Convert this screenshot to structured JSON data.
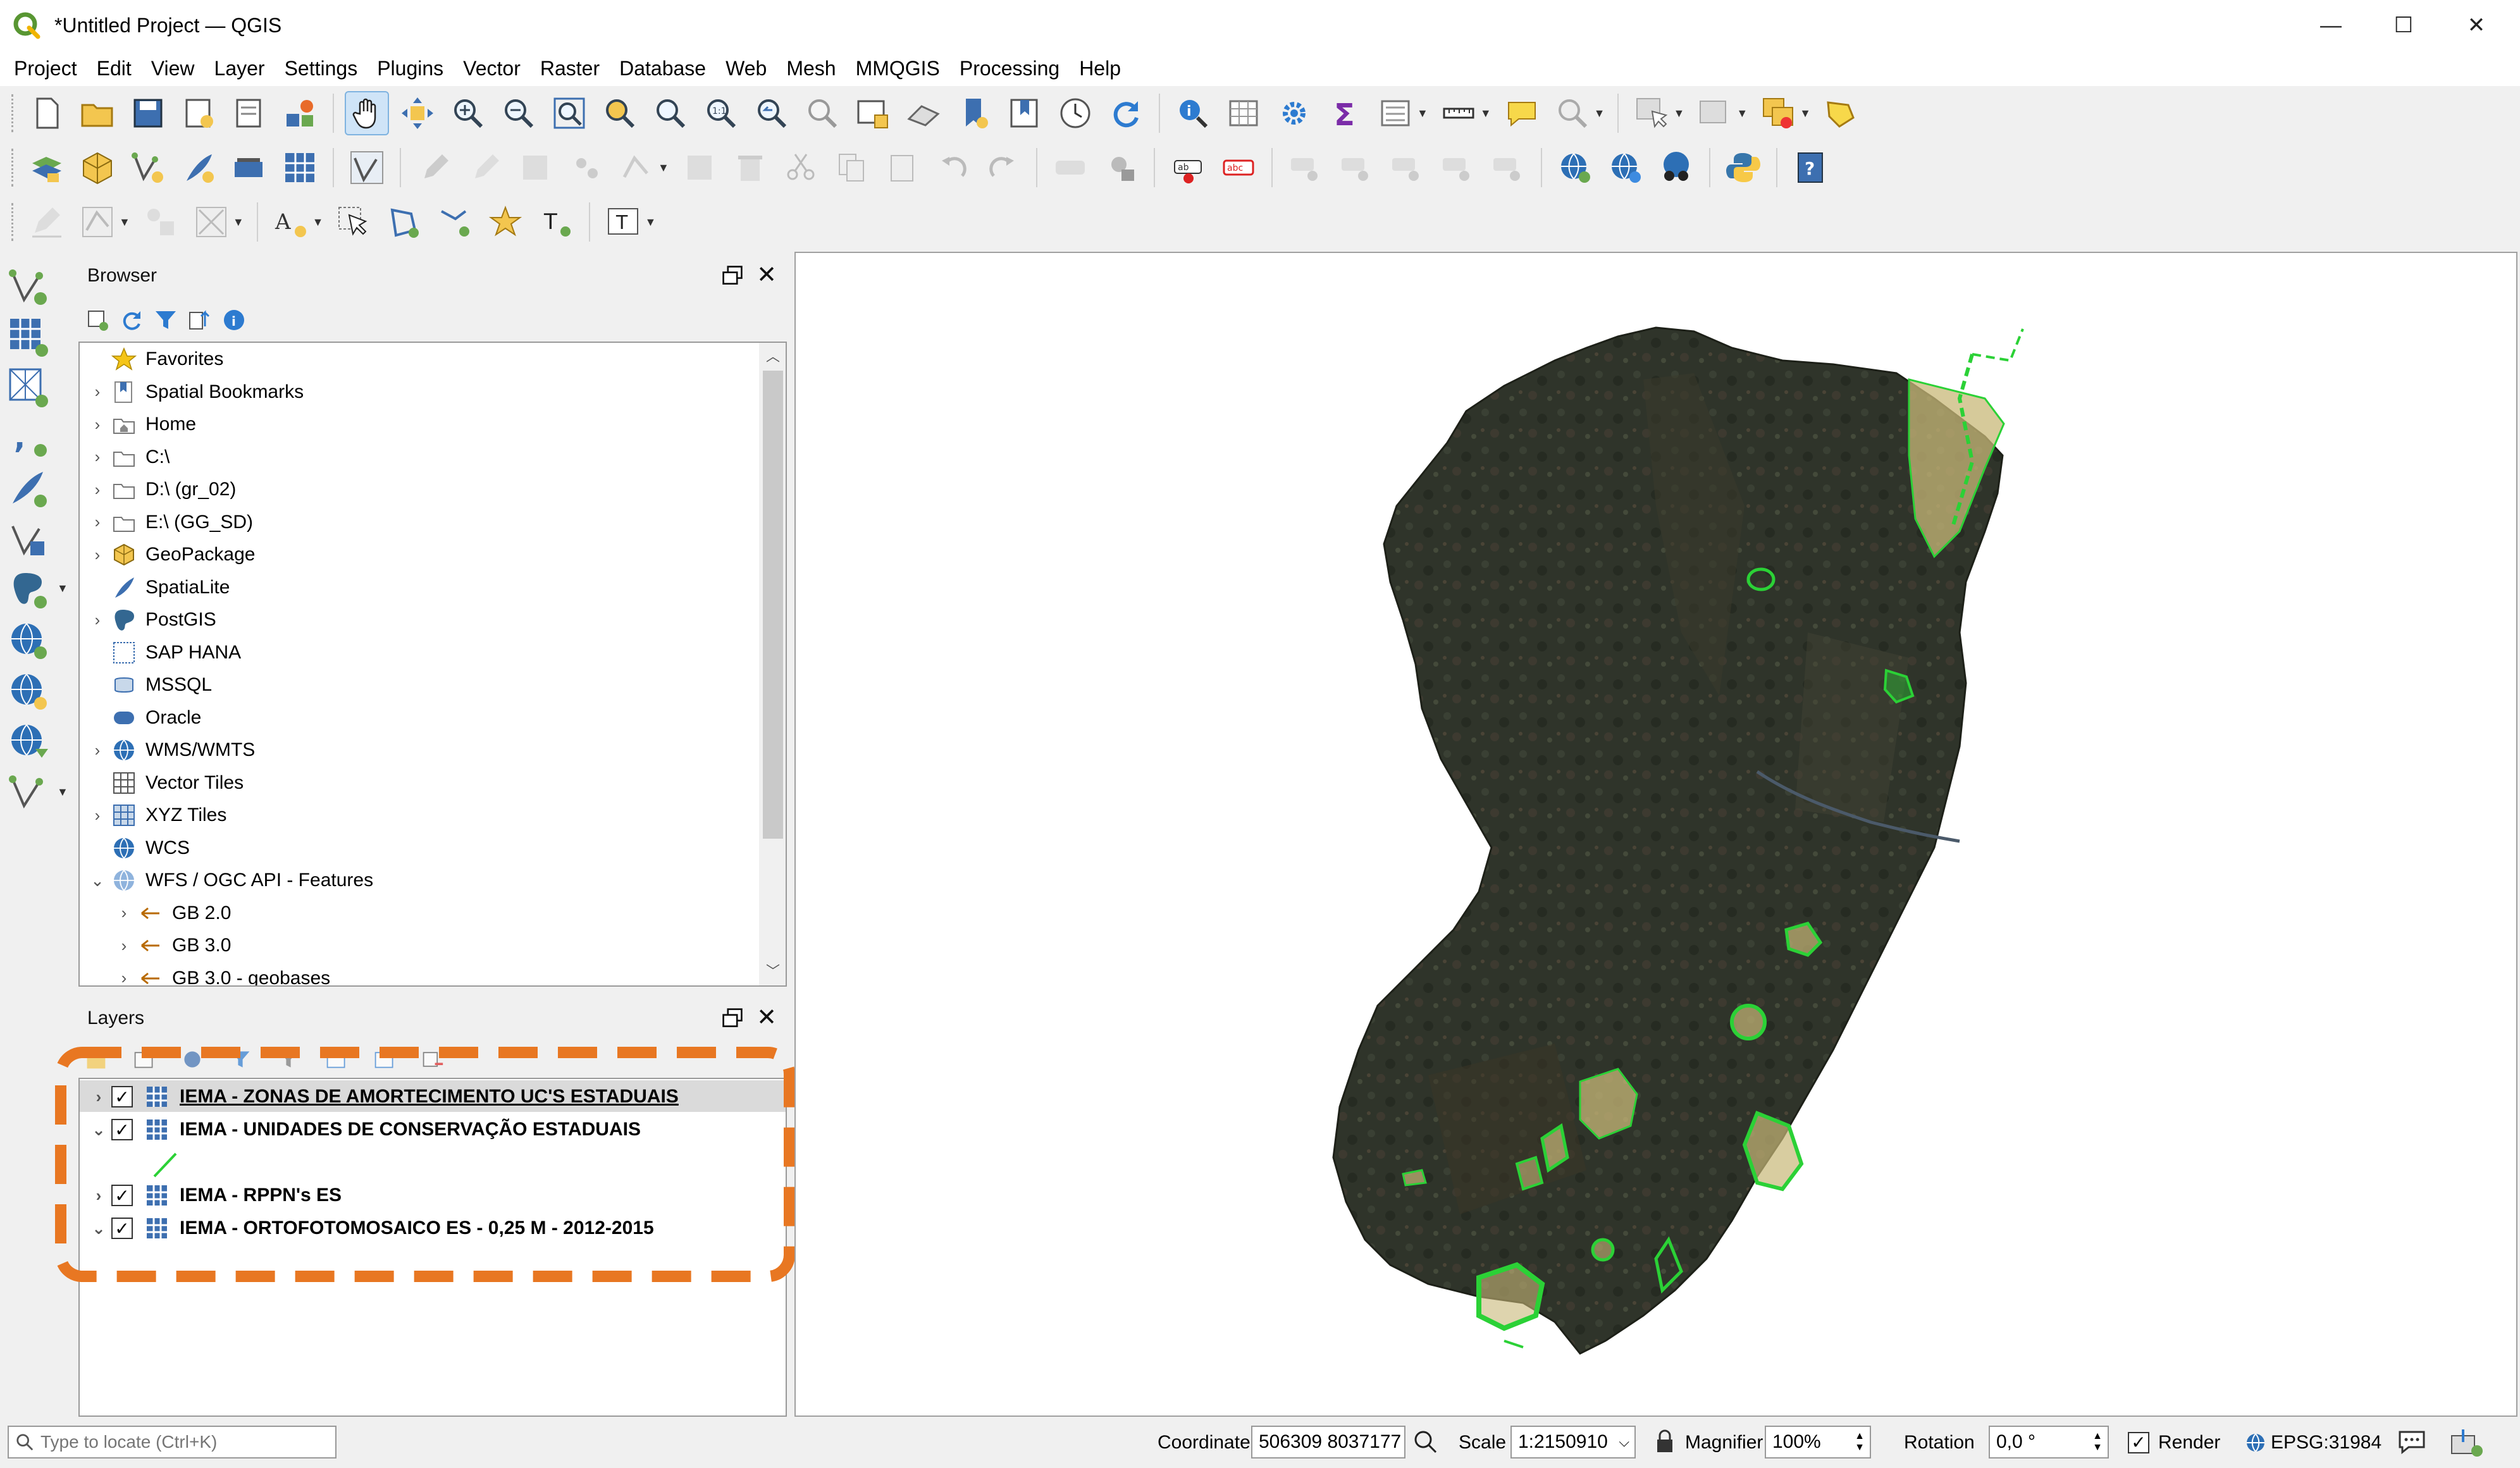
{
  "window": {
    "title": "*Untitled Project — QGIS",
    "minimize": "—",
    "maximize": "☐",
    "close": "✕"
  },
  "menu": [
    "Project",
    "Edit",
    "View",
    "Layer",
    "Settings",
    "Plugins",
    "Vector",
    "Raster",
    "Database",
    "Web",
    "Mesh",
    "MMQGIS",
    "Processing",
    "Help"
  ],
  "browser": {
    "title": "Browser",
    "items": [
      {
        "label": "Favorites",
        "icon": "star-icon",
        "expand": ""
      },
      {
        "label": "Spatial Bookmarks",
        "icon": "bookmark-icon",
        "expand": "›"
      },
      {
        "label": "Home",
        "icon": "home-folder-icon",
        "expand": "›"
      },
      {
        "label": "C:\\",
        "icon": "folder-icon",
        "expand": "›"
      },
      {
        "label": "D:\\ (gr_02)",
        "icon": "folder-icon",
        "expand": "›"
      },
      {
        "label": "E:\\ (GG_SD)",
        "icon": "folder-icon",
        "expand": "›"
      },
      {
        "label": "GeoPackage",
        "icon": "geopackage-icon",
        "expand": "›"
      },
      {
        "label": "SpatiaLite",
        "icon": "spatialite-icon",
        "expand": ""
      },
      {
        "label": "PostGIS",
        "icon": "postgis-icon",
        "expand": "›"
      },
      {
        "label": "SAP HANA",
        "icon": "sap-hana-icon",
        "expand": ""
      },
      {
        "label": "MSSQL",
        "icon": "mssql-icon",
        "expand": ""
      },
      {
        "label": "Oracle",
        "icon": "oracle-icon",
        "expand": ""
      },
      {
        "label": "WMS/WMTS",
        "icon": "wms-globe-icon",
        "expand": "›"
      },
      {
        "label": "Vector Tiles",
        "icon": "vector-tiles-icon",
        "expand": ""
      },
      {
        "label": "XYZ Tiles",
        "icon": "xyz-tiles-icon",
        "expand": "›"
      },
      {
        "label": "WCS",
        "icon": "wcs-globe-icon",
        "expand": ""
      },
      {
        "label": "WFS / OGC API - Features",
        "icon": "wfs-globe-icon",
        "expand": "⌄"
      }
    ],
    "children": [
      {
        "label": "GB 2.0",
        "icon": "connection-icon"
      },
      {
        "label": "GB 3.0",
        "icon": "connection-icon"
      },
      {
        "label": "GB 3.0 - geobases",
        "icon": "connection-icon"
      }
    ]
  },
  "layers": {
    "title": "Layers",
    "items": [
      {
        "label": "IEMA - ZONAS DE AMORTECIMENTO UC'S ESTADUAIS",
        "expand": "›",
        "checked": "✓",
        "selected": true
      },
      {
        "label": "IEMA - UNIDADES DE CONSERVAÇÃO ESTADUAIS",
        "expand": "⌄",
        "checked": "✓",
        "selected": false
      },
      {
        "label": "IEMA - RPPN's ES",
        "expand": "›",
        "checked": "✓",
        "selected": false
      },
      {
        "label": "IEMA - ORTOFOTOMOSAICO ES - 0,25 M - 2012-2015",
        "expand": "⌄",
        "checked": "✓",
        "selected": false
      }
    ],
    "highlight_color": "#e87722"
  },
  "status": {
    "search_placeholder": "Type to locate (Ctrl+K)",
    "coordinate_label": "Coordinate",
    "coordinate_value": "506309 8037177",
    "scale_label": "Scale",
    "scale_value": "1:2150910",
    "magnifier_label": "Magnifier",
    "magnifier_value": "100%",
    "rotation_label": "Rotation",
    "rotation_value": "0,0 °",
    "render_label": "Render",
    "crs": "EPSG:31984"
  },
  "colors": {
    "map_dark": "#2e3328",
    "protected_fill": "#c8b878",
    "protected_outline": "#2bd136",
    "accent_orange": "#e87722"
  }
}
